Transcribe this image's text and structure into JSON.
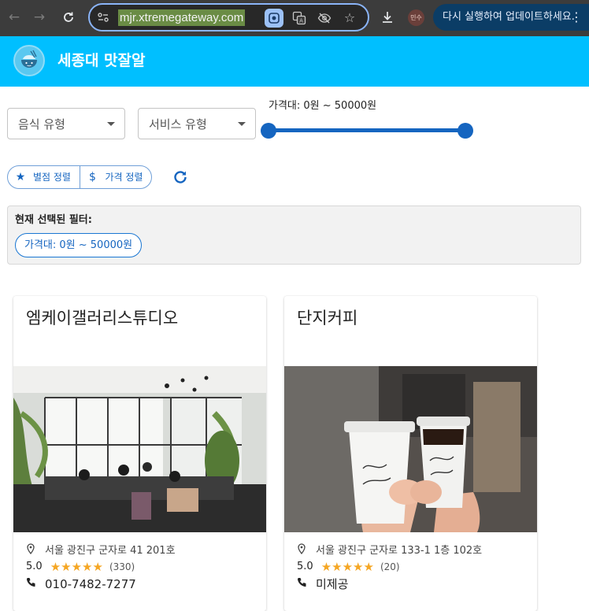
{
  "browser": {
    "url": "mjr.xtremegateway.com",
    "profile_label": "민수",
    "update_text": "다시 실행하여 업데이트하세요.",
    "menu_glyph": "⋮"
  },
  "app": {
    "title": "세종대 맛잘알",
    "accent_color": "#00bfff",
    "primary_color": "#1565c0"
  },
  "filters": {
    "food_type_label": "음식 유형",
    "service_type_label": "서비스 유형",
    "price_label": "가격대: 0원 ~ 50000원",
    "price_min": 0,
    "price_max": 50000,
    "price_range_fraction": [
      0.0,
      1.0
    ]
  },
  "sort": {
    "rating_sort_label": "별점 정렬",
    "price_sort_label": "가격 정렬",
    "rating_icon": "star-icon",
    "price_icon": "dollar-icon",
    "refresh_icon": "refresh-icon"
  },
  "current_filters": {
    "title": "현재 선택된 필터:",
    "chips": [
      "가격대: 0원 ~ 50000원"
    ]
  },
  "restaurants": [
    {
      "name": "엠케이갤러리스튜디오",
      "address": "서울 광진구 군자로 41 201호",
      "rating": "5.0",
      "stars": 5,
      "review_count": "(330)",
      "phone": "010-7482-7277"
    },
    {
      "name": "단지커피",
      "address": "서울 광진구 군자로 133-1 1층 102호",
      "rating": "5.0",
      "stars": 5,
      "review_count": "(20)",
      "phone": "미제공"
    }
  ]
}
